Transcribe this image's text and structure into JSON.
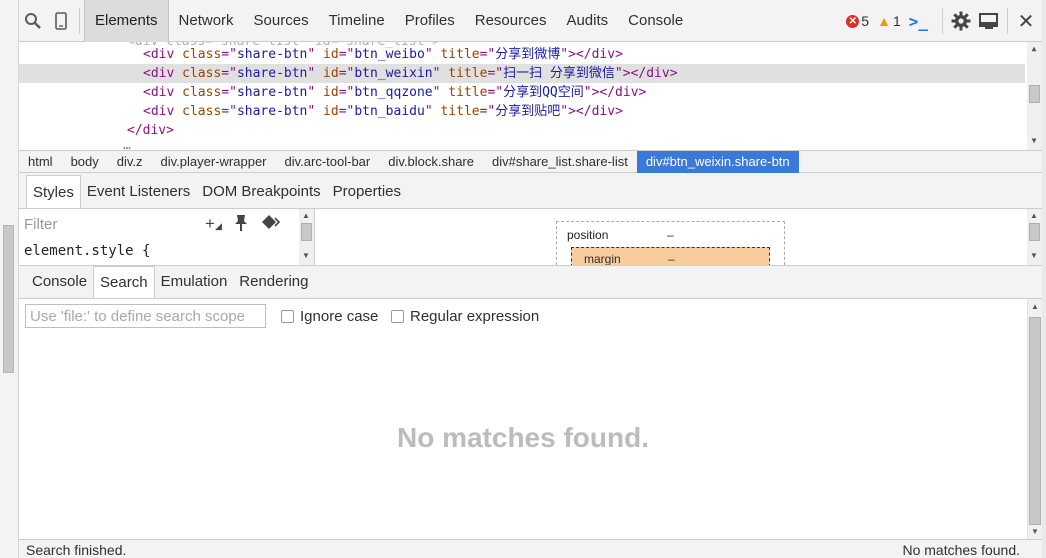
{
  "toolbar": {
    "tabs": [
      "Elements",
      "Network",
      "Sources",
      "Timeline",
      "Profiles",
      "Resources",
      "Audits",
      "Console"
    ],
    "active_tab": "Elements",
    "errors": "5",
    "warnings": "1"
  },
  "dom": {
    "lines": [
      {
        "indent": "  ",
        "parts": [
          [
            "tagc",
            "<div "
          ],
          [
            "attrn",
            "class"
          ],
          [
            "tagc",
            "=\""
          ],
          [
            "attrv",
            "share-btn"
          ],
          [
            "tagc",
            "\" "
          ],
          [
            "attrn",
            "id"
          ],
          [
            "tagc",
            "=\""
          ],
          [
            "attrv",
            "btn_weibo"
          ],
          [
            "tagc",
            "\" "
          ],
          [
            "attrn",
            "title"
          ],
          [
            "tagc",
            "=\""
          ],
          [
            "attrv",
            "分享到微博"
          ],
          [
            "tagc",
            "\"></div>"
          ]
        ]
      },
      {
        "indent": "  ",
        "parts": [
          [
            "tagc",
            "<div "
          ],
          [
            "attrn",
            "class"
          ],
          [
            "tagc",
            "=\""
          ],
          [
            "attrv",
            "share-btn"
          ],
          [
            "tagc",
            "\" "
          ],
          [
            "attrn",
            "id"
          ],
          [
            "tagc",
            "=\""
          ],
          [
            "attrv",
            "btn_weixin"
          ],
          [
            "tagc",
            "\" "
          ],
          [
            "attrn",
            "title"
          ],
          [
            "tagc",
            "=\""
          ],
          [
            "attrv",
            "扫一扫 分享到微信"
          ],
          [
            "tagc",
            "\"></div>"
          ]
        ]
      },
      {
        "indent": "  ",
        "parts": [
          [
            "tagc",
            "<div "
          ],
          [
            "attrn",
            "class"
          ],
          [
            "tagc",
            "=\""
          ],
          [
            "attrv",
            "share-btn"
          ],
          [
            "tagc",
            "\" "
          ],
          [
            "attrn",
            "id"
          ],
          [
            "tagc",
            "=\""
          ],
          [
            "attrv",
            "btn_qqzone"
          ],
          [
            "tagc",
            "\" "
          ],
          [
            "attrn",
            "title"
          ],
          [
            "tagc",
            "=\""
          ],
          [
            "attrv",
            "分享到QQ空间"
          ],
          [
            "tagc",
            "\"></div>"
          ]
        ]
      },
      {
        "indent": "  ",
        "parts": [
          [
            "tagc",
            "<div "
          ],
          [
            "attrn",
            "class"
          ],
          [
            "tagc",
            "=\""
          ],
          [
            "attrv",
            "share-btn"
          ],
          [
            "tagc",
            "\" "
          ],
          [
            "attrn",
            "id"
          ],
          [
            "tagc",
            "=\""
          ],
          [
            "attrv",
            "btn_baidu"
          ],
          [
            "tagc",
            "\" "
          ],
          [
            "attrn",
            "title"
          ],
          [
            "tagc",
            "=\""
          ],
          [
            "attrv",
            "分享到贴吧"
          ],
          [
            "tagc",
            "\"></div>"
          ]
        ]
      },
      {
        "indent": "",
        "parts": [
          [
            "tagc",
            "</div>"
          ]
        ]
      }
    ]
  },
  "breadcrumbs": [
    "html",
    "body",
    "div.z",
    "div.player-wrapper",
    "div.arc-tool-bar",
    "div.block.share",
    "div#share_list.share-list",
    "div#btn_weixin.share-btn"
  ],
  "styles": {
    "tabs": [
      "Styles",
      "Event Listeners",
      "DOM Breakpoints",
      "Properties"
    ],
    "filter_placeholder": "Filter",
    "element_style": "element.style {",
    "box_position_label": "position",
    "box_position_value": "–",
    "box_margin_label": "margin",
    "box_margin_value": "–"
  },
  "drawer": {
    "tabs": [
      "Console",
      "Search",
      "Emulation",
      "Rendering"
    ],
    "search_placeholder": "Use 'file:' to define search scope",
    "ignore_case": "Ignore case",
    "regex": "Regular expression",
    "empty_message": "No matches found."
  },
  "status": {
    "left": "Search finished.",
    "right": "No matches found."
  }
}
